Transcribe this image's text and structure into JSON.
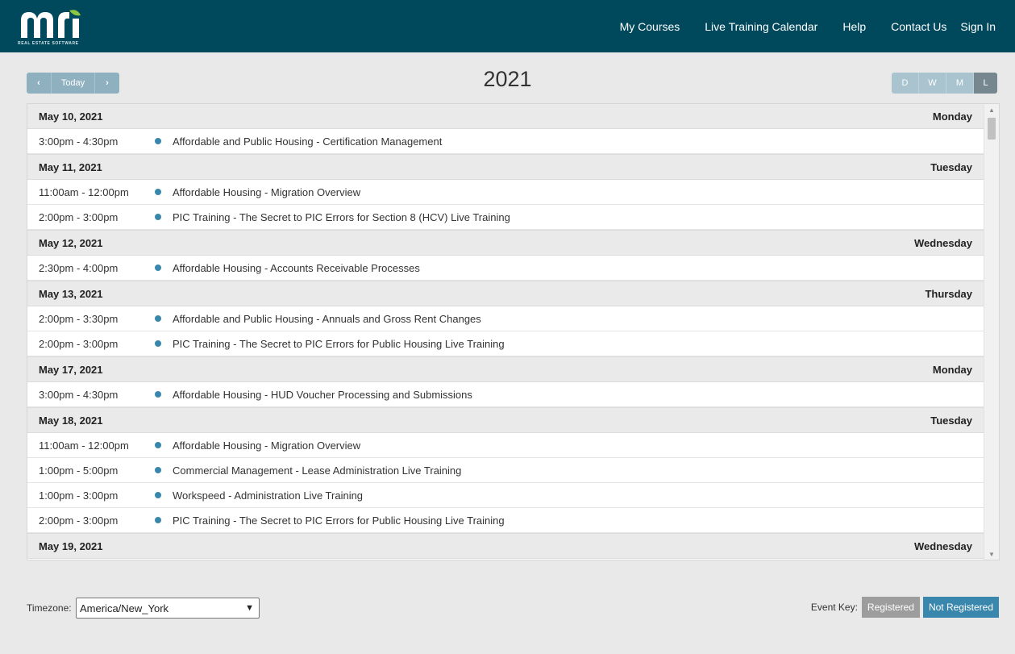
{
  "header": {
    "logo_text": "mri",
    "logo_subtitle": "REAL ESTATE SOFTWARE",
    "nav": [
      "My Courses",
      "Live Training Calendar",
      "Help",
      "Contact Us",
      "Sign In"
    ]
  },
  "toolbar": {
    "prev_icon": "‹",
    "today_label": "Today",
    "next_icon": "›",
    "title": "2021",
    "views": [
      "D",
      "W",
      "M",
      "L"
    ],
    "active_view": "L"
  },
  "days": [
    {
      "date": "May 10, 2021",
      "weekday": "Monday",
      "events": [
        {
          "time": "3:00pm - 4:30pm",
          "title": "Affordable and Public Housing - Certification Management"
        }
      ]
    },
    {
      "date": "May 11, 2021",
      "weekday": "Tuesday",
      "events": [
        {
          "time": "11:00am - 12:00pm",
          "title": "Affordable Housing - Migration Overview"
        },
        {
          "time": "2:00pm - 3:00pm",
          "title": "PIC Training - The Secret to PIC Errors for Section 8 (HCV) Live Training"
        }
      ]
    },
    {
      "date": "May 12, 2021",
      "weekday": "Wednesday",
      "events": [
        {
          "time": "2:30pm - 4:00pm",
          "title": "Affordable Housing - Accounts Receivable Processes"
        }
      ]
    },
    {
      "date": "May 13, 2021",
      "weekday": "Thursday",
      "events": [
        {
          "time": "2:00pm - 3:30pm",
          "title": "Affordable and Public Housing - Annuals and Gross Rent Changes"
        },
        {
          "time": "2:00pm - 3:00pm",
          "title": "PIC Training - The Secret to PIC Errors for Public Housing Live Training"
        }
      ]
    },
    {
      "date": "May 17, 2021",
      "weekday": "Monday",
      "events": [
        {
          "time": "3:00pm - 4:30pm",
          "title": "Affordable Housing - HUD Voucher Processing and Submissions"
        }
      ]
    },
    {
      "date": "May 18, 2021",
      "weekday": "Tuesday",
      "events": [
        {
          "time": "11:00am - 12:00pm",
          "title": "Affordable Housing - Migration Overview"
        },
        {
          "time": "1:00pm - 5:00pm",
          "title": "Commercial Management - Lease Administration Live Training"
        },
        {
          "time": "1:00pm - 3:00pm",
          "title": "Workspeed - Administration Live Training"
        },
        {
          "time": "2:00pm - 3:00pm",
          "title": "PIC Training - The Secret to PIC Errors for Public Housing Live Training"
        }
      ]
    },
    {
      "date": "May 19, 2021",
      "weekday": "Wednesday",
      "events": []
    }
  ],
  "footer": {
    "timezone_label": "Timezone:",
    "timezone_value": "America/New_York",
    "event_key_label": "Event Key:",
    "registered_label": "Registered",
    "not_registered_label": "Not Registered"
  },
  "colors": {
    "header_bg": "#00485c",
    "event_dot": "#3a87ad",
    "registered": "#9d9d9d",
    "not_registered": "#3a87ad"
  }
}
